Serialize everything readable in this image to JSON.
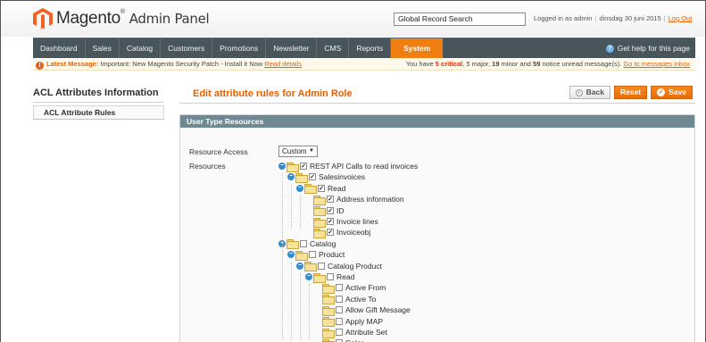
{
  "header": {
    "logo_main": "Magento",
    "logo_sub": "Admin Panel",
    "search_value": "Global Record Search",
    "logged_in": "Logged in as admin",
    "date": "dinsdag 30 juni 2015",
    "logout": "Log Out"
  },
  "nav": {
    "items": [
      "Dashboard",
      "Sales",
      "Catalog",
      "Customers",
      "Promotions",
      "Newsletter",
      "CMS",
      "Reports",
      "System"
    ],
    "active": "System",
    "help": "Get help for this page"
  },
  "notice": {
    "label": "Latest Message:",
    "message": "Important: New Magento Security Patch - Install it Now",
    "read_details": "Read details",
    "summary_prefix": "You have",
    "critical_count": "5 critical",
    "major_text": ", 5 major, ",
    "minor_count": "19",
    "minor_text": " minor and ",
    "notice_count": "59",
    "notice_text": " notice unread message(s).",
    "inbox_link": "Go to messages inbox"
  },
  "sidebar": {
    "title": "ACL Attributes Information",
    "tab": "ACL Attribute Rules"
  },
  "main": {
    "title": "Edit attribute rules for Admin Role",
    "buttons": {
      "back": "Back",
      "reset": "Reset",
      "save": "Save"
    },
    "panel_title": "User Type Resources",
    "resource_access_label": "Resource Access",
    "resource_access_value": "Custom",
    "resources_label": "Resources"
  },
  "tree": [
    {
      "label": "REST API Calls to read invoices",
      "checked": true,
      "toggle": "−",
      "level": 0
    },
    {
      "label": "Salesinvoices",
      "checked": true,
      "toggle": "−",
      "level": 1
    },
    {
      "label": "Read",
      "checked": true,
      "toggle": "−",
      "level": 2
    },
    {
      "label": "Address information",
      "checked": true,
      "toggle": "",
      "level": 3
    },
    {
      "label": "ID",
      "checked": true,
      "toggle": "",
      "level": 3
    },
    {
      "label": "Invoice lines",
      "checked": true,
      "toggle": "",
      "level": 3
    },
    {
      "label": "Invoiceobj",
      "checked": true,
      "toggle": "",
      "level": 3
    },
    {
      "label": "Catalog",
      "checked": false,
      "toggle": "−",
      "level": 0
    },
    {
      "label": "Product",
      "checked": false,
      "toggle": "−",
      "level": 1
    },
    {
      "label": "Catalog Product",
      "checked": false,
      "toggle": "−",
      "level": 2
    },
    {
      "label": "Read",
      "checked": false,
      "toggle": "−",
      "level": 3
    },
    {
      "label": "Active From",
      "checked": false,
      "toggle": "",
      "level": 4
    },
    {
      "label": "Active To",
      "checked": false,
      "toggle": "",
      "level": 4
    },
    {
      "label": "Allow Gift Message",
      "checked": false,
      "toggle": "",
      "level": 4
    },
    {
      "label": "Apply MAP",
      "checked": false,
      "toggle": "",
      "level": 4
    },
    {
      "label": "Attribute Set",
      "checked": false,
      "toggle": "",
      "level": 4
    },
    {
      "label": "Color",
      "checked": false,
      "toggle": "",
      "level": 4
    }
  ],
  "colors": {
    "accent": "#eb5e00",
    "nav_bg": "#48565c",
    "nav_active": "#ee7f10",
    "panel_head": "#6f8992"
  }
}
